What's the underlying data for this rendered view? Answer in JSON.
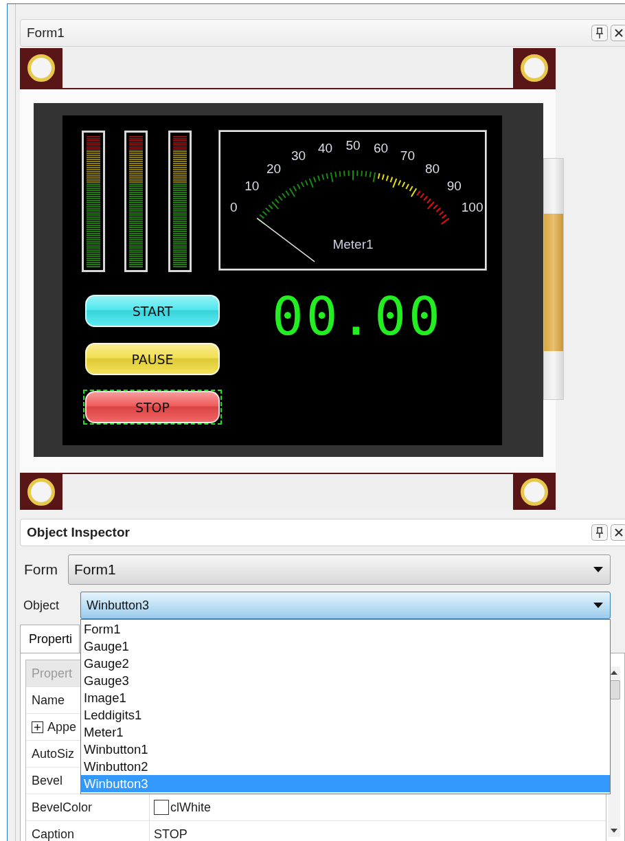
{
  "designer": {
    "title": "Form1",
    "screen": {
      "meter": {
        "scale": [
          "0",
          "10",
          "20",
          "30",
          "40",
          "50",
          "60",
          "70",
          "80",
          "90",
          "100"
        ],
        "caption": "Meter1"
      },
      "buttons": [
        {
          "label": "START",
          "color": "#3ee6ee",
          "selected": false
        },
        {
          "label": "PAUSE",
          "color": "#f2dc3c",
          "selected": false
        },
        {
          "label": "STOP",
          "color": "#ee4a4a",
          "selected": true
        }
      ],
      "led": {
        "value": "00.00"
      }
    }
  },
  "inspector": {
    "title": "Object Inspector",
    "form": {
      "label": "Form",
      "value": "Form1"
    },
    "object": {
      "label": "Object",
      "value": "Winbutton3",
      "expanded": true,
      "options": [
        {
          "label": "Form1",
          "selected": false
        },
        {
          "label": "Gauge1",
          "selected": false
        },
        {
          "label": "Gauge2",
          "selected": false
        },
        {
          "label": "Gauge3",
          "selected": false
        },
        {
          "label": "Image1",
          "selected": false
        },
        {
          "label": "Leddigits1",
          "selected": false
        },
        {
          "label": "Meter1",
          "selected": false
        },
        {
          "label": "Winbutton1",
          "selected": false
        },
        {
          "label": "Winbutton2",
          "selected": false
        },
        {
          "label": "Winbutton3",
          "selected": true
        }
      ]
    },
    "tabs": [
      {
        "label": "Properti",
        "selected": true
      }
    ],
    "grid": {
      "header": "Propert",
      "rows": [
        {
          "kind": "text",
          "name": "Name"
        },
        {
          "kind": "group",
          "name": "Appe",
          "expanded": false
        },
        {
          "kind": "text",
          "name": "AutoSiz"
        },
        {
          "kind": "text",
          "name": "Bevel"
        },
        {
          "kind": "color",
          "name": "BevelColor",
          "color": "#ffffff",
          "value": "clWhite"
        },
        {
          "kind": "text",
          "name": "Caption",
          "value": "STOP"
        }
      ]
    }
  }
}
